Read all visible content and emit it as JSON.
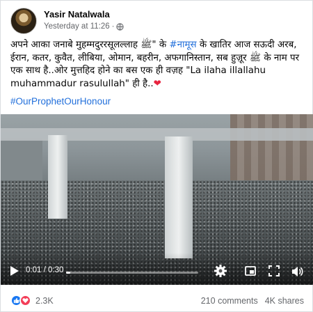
{
  "post": {
    "author": "Yasir Natalwala",
    "timestamp": "Yesterday at 11:26",
    "separator": "·",
    "privacy_icon": "globe-icon",
    "text_part1": "अपने आका जनाबे मुहम्मदुररसूलल्लाह ﷺ\"  के ",
    "text_tag": "#नामूस",
    "text_part2": " के खातिर आज सऊदी अरब, ईरान, कतर, कुवैत, लीबिया, ओमान, बहरीन, अफगानिस्तान, सब हुज़ूर ﷺ के नाम पर एक साथ है..ओर मुत्तहिद होने का बस एक ही वज़ह \"La ilaha illallahu muhammadur rasulullah\" ही है..",
    "text_heart": "❤",
    "hashtag": "#OurProphetOurHonour"
  },
  "video": {
    "current_time": "0:01",
    "duration": "0:30",
    "time_separator": " / ",
    "progress": 0.033,
    "icons": [
      "play-icon",
      "settings-gear-icon",
      "expand-icon",
      "fullscreen-icon",
      "volume-icon"
    ]
  },
  "footer": {
    "reaction_count": "2.3K",
    "comments": "210 comments",
    "shares": "4K shares"
  },
  "colors": {
    "link": "#216fdb",
    "secondary_text": "#65676b",
    "like_blue": "#1877f2",
    "love_red": "#f33e58"
  }
}
